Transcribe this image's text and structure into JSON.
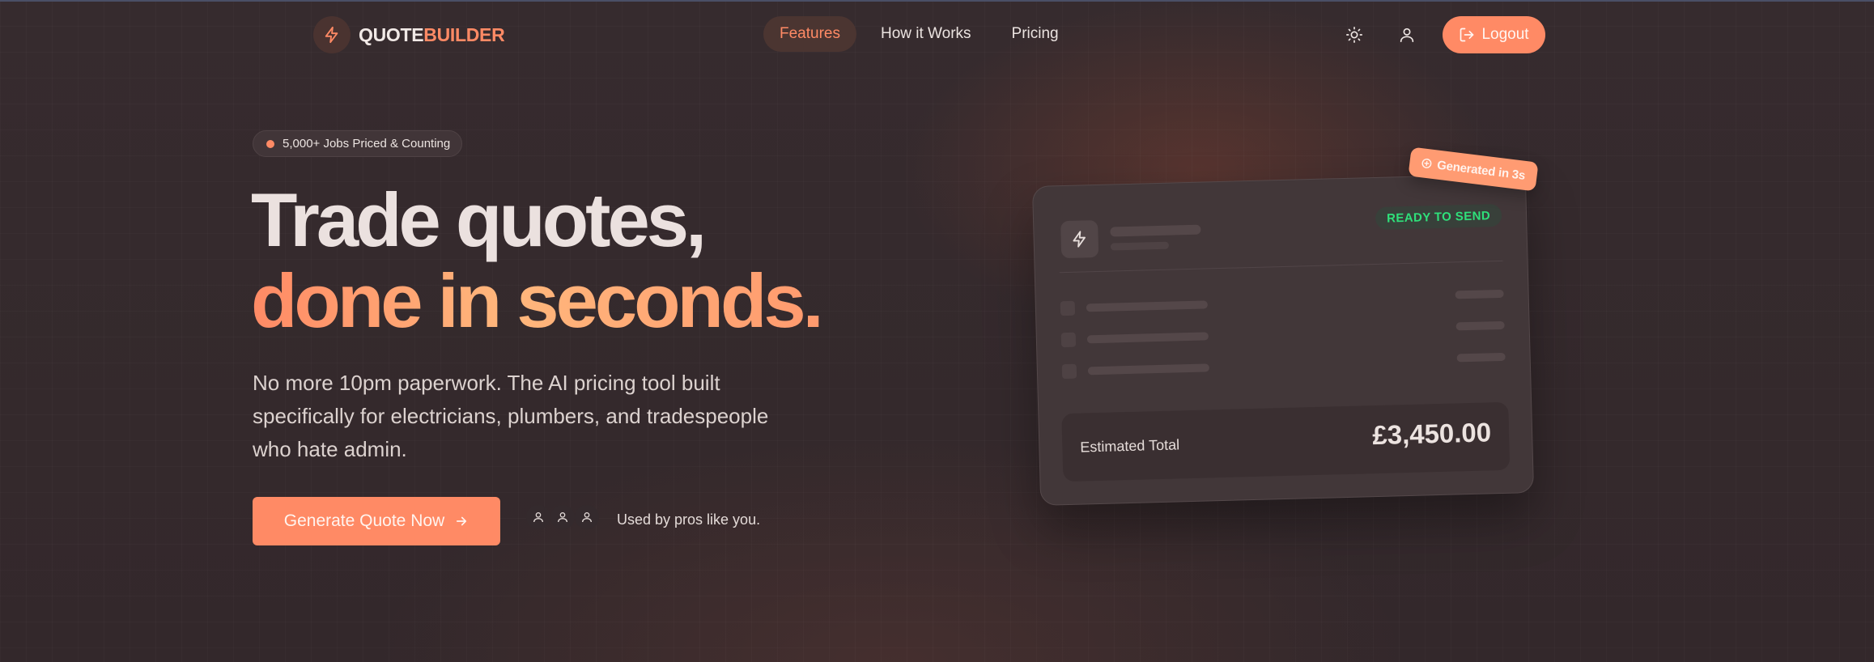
{
  "brand": {
    "name_part1": "QUOTE",
    "name_part2": "BUILDER",
    "accent": "#ff8a65",
    "logo_icon": "bolt-icon"
  },
  "nav": {
    "items": [
      {
        "label": "Features",
        "active": true
      },
      {
        "label": "How it Works",
        "active": false
      },
      {
        "label": "Pricing",
        "active": false
      }
    ],
    "theme_icon": "sun-icon",
    "user_icon": "user-icon",
    "logout_label": "Logout",
    "logout_icon": "logout-icon"
  },
  "hero": {
    "badge": "5,000+ Jobs Priced & Counting",
    "headline_line1": "Trade quotes,",
    "headline_line2": "done in seconds.",
    "subtitle": "No more 10pm paperwork. The AI pricing tool built specifically for electricians, plumbers, and tradespeople who hate admin.",
    "cta_label": "Generate Quote Now",
    "cta_icon": "arrow-right-icon",
    "social_proof": "Used by pros like you."
  },
  "preview_card": {
    "status": "READY TO SEND",
    "status_color": "#2fe07a",
    "tag": "Generated in 3s",
    "tag_icon": "sparkle-icon",
    "total_label": "Estimated Total",
    "total_value": "£3,450.00"
  }
}
